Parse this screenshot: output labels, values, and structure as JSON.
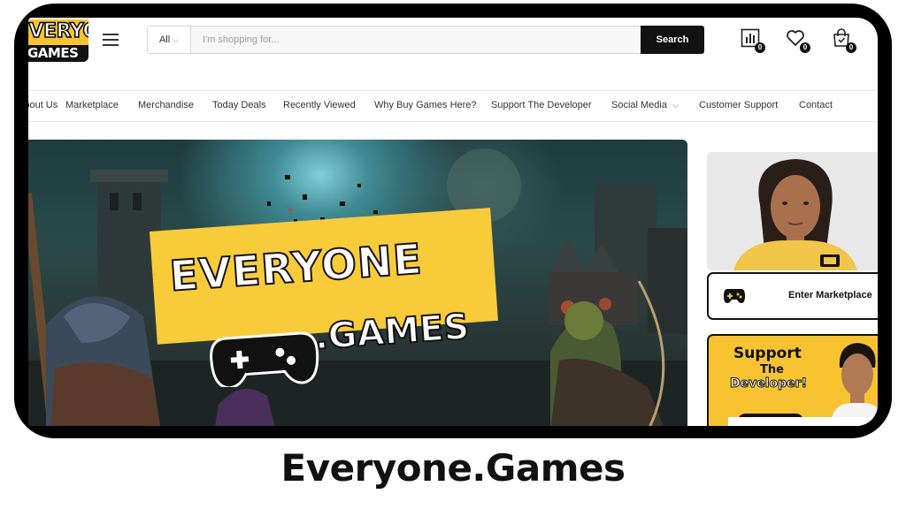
{
  "header": {
    "logo_line1": "EVERYONE",
    "logo_line2": "GAMES",
    "search": {
      "category": "All",
      "placeholder": "I'm shopping for...",
      "button": "Search"
    },
    "icons": [
      {
        "name": "compare-icon",
        "count": "0"
      },
      {
        "name": "wishlist-heart-icon",
        "count": "0"
      },
      {
        "name": "cart-bag-icon",
        "count": "0"
      }
    ]
  },
  "nav": {
    "items": [
      "About Us",
      "Marketplace",
      "Merchandise",
      "Today Deals",
      "Recently Viewed",
      "Why Buy Games Here?",
      "Support The Developer",
      "Social Media",
      "Customer Support",
      "Contact"
    ]
  },
  "hero": {
    "line1": "EVERYONE",
    "line2": ".GAMES"
  },
  "sidebar": {
    "market_button": "Enter Marketplace",
    "support_line1": "Support",
    "support_line2": "The",
    "support_line3": "Developer!"
  },
  "caption": "Everyone.Games",
  "colors": {
    "brand_yellow": "#f7c331",
    "dark": "#111111"
  }
}
